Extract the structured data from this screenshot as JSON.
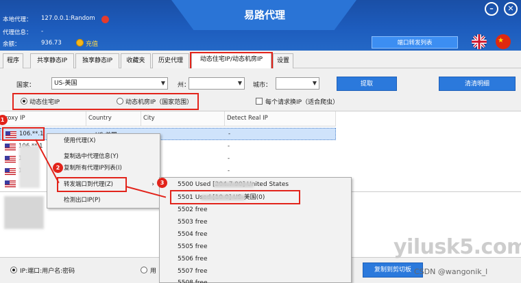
{
  "app": {
    "title": "易路代理"
  },
  "info": {
    "local_proxy_label": "本地代理：",
    "local_proxy_value": "127.0.0.1:Random",
    "proxy_info_label": "代理信息：",
    "proxy_info_value": "-",
    "balance_label": "余额：",
    "balance_value": "936.73",
    "recharge_label": "充值"
  },
  "window": {
    "minimize": "–",
    "close": "✕"
  },
  "header": {
    "port_forward_list": "端口转发列表"
  },
  "tabs": [
    "程序",
    "共享静态IP",
    "独享静态IP",
    "收藏夹",
    "历史代理",
    "动态住宅IP/动态机房IP",
    "设置"
  ],
  "filters": {
    "country_label": "国家：",
    "country_value": "US-美国",
    "state_label": "州：",
    "city_label": "城市：",
    "extract_button": "提取",
    "clear_button": "清清明细",
    "radio_residential": "动态住宅IP",
    "radio_datacenter": "动态机房IP（国家范围）",
    "checkbox_rotate": "每个请求换IP（适合爬虫）"
  },
  "table": {
    "headers": [
      "Proxy IP",
      "Country",
      "City",
      "Detect Real IP"
    ],
    "rows": [
      {
        "ip": "106.**.1",
        "country": "US-美国",
        "detect": "-"
      },
      {
        "ip": "106.**.1",
        "country": "",
        "detect": "-"
      },
      {
        "ip": "1",
        "country": "",
        "detect": "-"
      },
      {
        "ip": "1",
        "country": "",
        "detect": "-"
      },
      {
        "ip": "",
        "country": "",
        "detect": "-"
      }
    ]
  },
  "context_menu": {
    "items": [
      "使用代理(X)",
      "复制选中代理信息(Y)",
      "复制所有代理IP列表(I)",
      "转发端口到代理(Z)",
      "检测出口IP(P)"
    ]
  },
  "submenu": {
    "items": [
      "5500 Used [204.7      90] United States",
      "5501 Used [10            0] US-美国(0)",
      "5502 free",
      "5503 free",
      "5504 free",
      "5505 free",
      "5506 free",
      "5507 free",
      "5508 free"
    ]
  },
  "badges": [
    "1",
    "2",
    "3"
  ],
  "bottom": {
    "radio_format": "IP:端口:用户名:密码",
    "radio_other": "用",
    "copy_button": "复制到剪切板"
  },
  "watermark": "yilusk5.com",
  "credit": "CSDN @wangonik_l",
  "colors": {
    "header_blue": "#1d5cbd",
    "button_blue": "#2b79dc",
    "highlight_red": "#e2231a"
  }
}
